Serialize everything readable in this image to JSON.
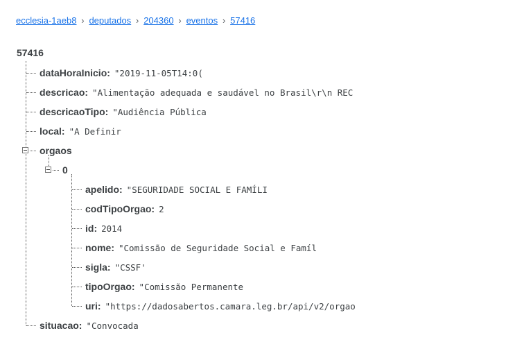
{
  "breadcrumb": {
    "items": [
      "ecclesia-1aeb8",
      "deputados",
      "204360",
      "eventos",
      "57416"
    ],
    "separator": "›"
  },
  "root": {
    "title": "57416",
    "fields": [
      {
        "key": "dataHoraInicio:",
        "value": "\"2019-11-05T14:0("
      },
      {
        "key": "descricao:",
        "value": "\"Alimentação adequada e saudável no Brasil\\r\\n REC"
      },
      {
        "key": "descricaoTipo:",
        "value": "\"Audiência Pública"
      },
      {
        "key": "local:",
        "value": "\"A Definir"
      }
    ],
    "orgaos": {
      "key": "orgaos",
      "item": {
        "key": "0",
        "fields": [
          {
            "key": "apelido:",
            "value": "\"SEGURIDADE SOCIAL E FAMÍLI"
          },
          {
            "key": "codTipoOrgao:",
            "value": "2"
          },
          {
            "key": "id:",
            "value": "2014"
          },
          {
            "key": "nome:",
            "value": "\"Comissão de Seguridade Social e Famíl"
          },
          {
            "key": "sigla:",
            "value": "\"CSSF'"
          },
          {
            "key": "tipoOrgao:",
            "value": "\"Comissão Permanente"
          },
          {
            "key": "uri:",
            "value": "\"https://dadosabertos.camara.leg.br/api/v2/orgao"
          }
        ]
      }
    },
    "situacao": {
      "key": "situacao:",
      "value": "\"Convocada"
    }
  }
}
